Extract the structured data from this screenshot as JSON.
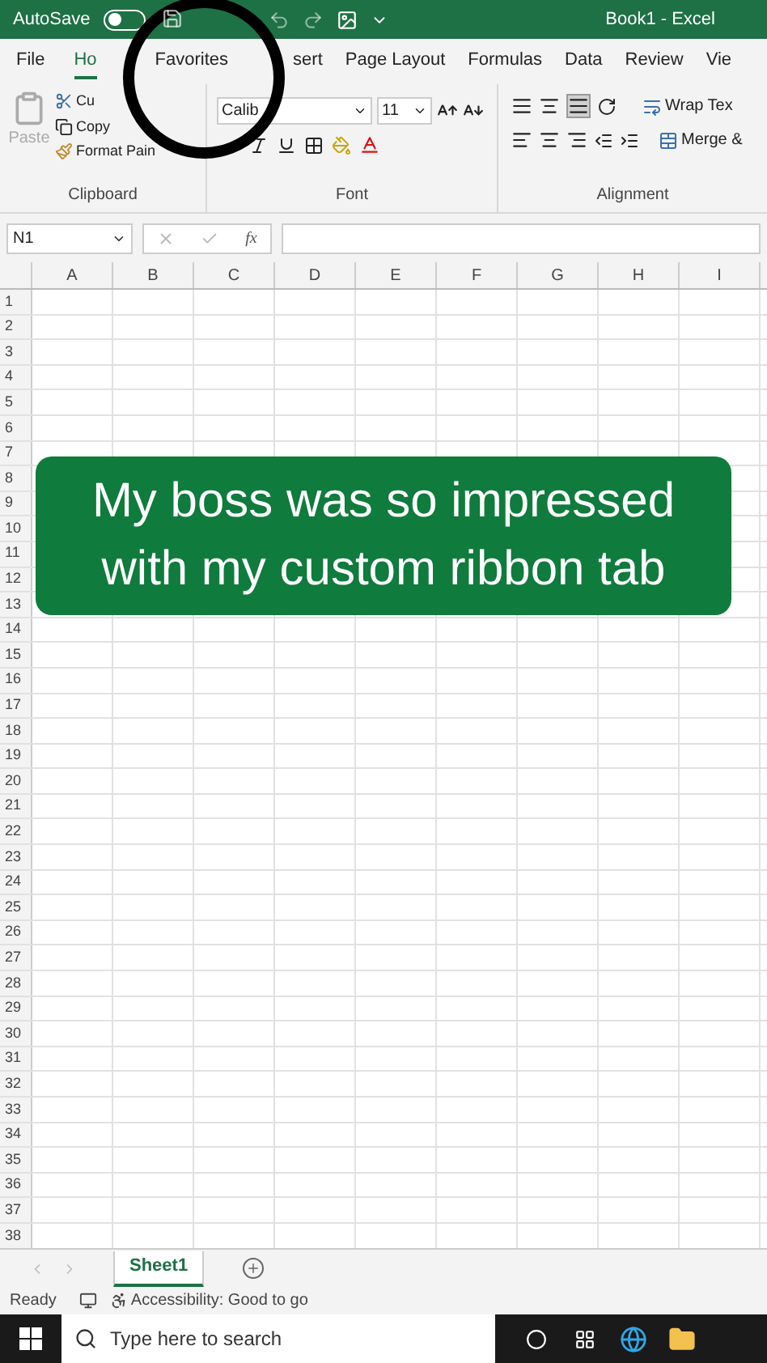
{
  "title_bar": {
    "autosave_label": "AutoSave",
    "autosave_on": false,
    "title": "Book1 - Excel"
  },
  "tabs": [
    {
      "label": "File",
      "selected": false
    },
    {
      "label": "Ho",
      "selected": true
    },
    {
      "label": "Favorites",
      "selected": false
    },
    {
      "label": "sert",
      "selected": false
    },
    {
      "label": "Page Layout",
      "selected": false
    },
    {
      "label": "Formulas",
      "selected": false
    },
    {
      "label": "Data",
      "selected": false
    },
    {
      "label": "Review",
      "selected": false
    },
    {
      "label": "Vie",
      "selected": false
    }
  ],
  "ribbon": {
    "clipboard": {
      "paste": "Paste",
      "cut": "Cu",
      "copy": "Copy",
      "format_painter": "Format Pain",
      "label": "Clipboard"
    },
    "font": {
      "name": "Calib",
      "size": "11",
      "label": "Font"
    },
    "alignment": {
      "wrap": "Wrap Tex",
      "merge": "Merge &",
      "label": "Alignment"
    }
  },
  "formula_bar": {
    "name_box": "N1",
    "fx": "fx"
  },
  "columns": [
    "A",
    "B",
    "C",
    "D",
    "E",
    "F",
    "G",
    "H",
    "I"
  ],
  "rows": [
    "1",
    "2",
    "3",
    "4",
    "5",
    "6",
    "7",
    "8",
    "9",
    "10",
    "11",
    "12",
    "13",
    "14",
    "15",
    "16",
    "17",
    "18",
    "19",
    "20",
    "21",
    "22",
    "23",
    "24",
    "25",
    "26",
    "27",
    "28",
    "29",
    "30",
    "31",
    "32",
    "33",
    "34",
    "35",
    "36",
    "37",
    "38"
  ],
  "caption": [
    "My boss was so impressed",
    "with my custom ribbon tab"
  ],
  "sheet_tabs": [
    {
      "label": "Sheet1",
      "selected": true
    }
  ],
  "status_bar": {
    "ready": "Ready",
    "accessibility": "Accessibility: Good to go"
  },
  "taskbar": {
    "search_placeholder": "Type here to search"
  }
}
